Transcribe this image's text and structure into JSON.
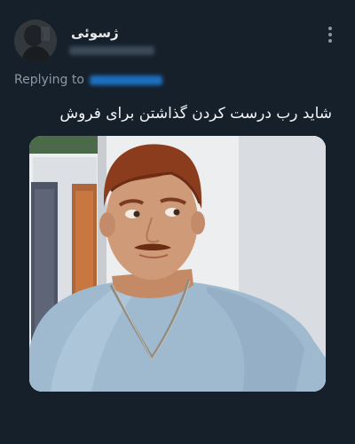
{
  "tweet": {
    "display_name": "ژسوئی",
    "reply_label": "Replying to",
    "text": "شاید رب درست کردن گذاشتن برای فروش",
    "more_icon": "more-vertical-icon",
    "media_alt": "meme-photo-man-blue-shirt-looking-sideways"
  },
  "colors": {
    "background": "#15202b",
    "text_primary": "#e7e9ea",
    "text_secondary": "#8b98a5",
    "link": "#1d9bf0"
  }
}
